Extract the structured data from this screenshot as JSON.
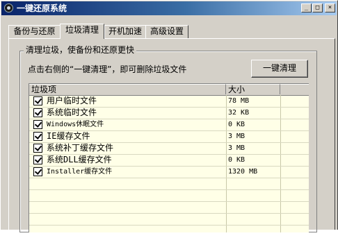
{
  "window": {
    "title": "一键还原系统",
    "minimize_glyph": "_",
    "maximize_glyph": "□",
    "close_glyph": "×"
  },
  "tabs": [
    {
      "label": "备份与还原"
    },
    {
      "label": "垃圾清理"
    },
    {
      "label": "开机加速"
    },
    {
      "label": "高级设置"
    }
  ],
  "active_tab": "垃圾清理",
  "group": {
    "title": "清理垃圾，使备份和还原更快",
    "hint": "点击右侧的“一键清理”，即可删除垃圾文件",
    "clean_button": "一键清理"
  },
  "list": {
    "columns": [
      "垃圾项",
      "大小"
    ],
    "rows": [
      {
        "name": "用户临时文件",
        "size": "78 MB",
        "checked": true
      },
      {
        "name": "系统临时文件",
        "size": "32 KB",
        "checked": true
      },
      {
        "name": "Windows休眠文件",
        "size": "0 KB",
        "checked": true
      },
      {
        "name": "IE缓存文件",
        "size": "3 MB",
        "checked": true
      },
      {
        "name": "系统补丁缓存文件",
        "size": "3 MB",
        "checked": true
      },
      {
        "name": "系统DLL缓存文件",
        "size": "0 KB",
        "checked": true
      },
      {
        "name": "Installer缓存文件",
        "size": "1320 MB",
        "checked": true
      }
    ]
  }
}
